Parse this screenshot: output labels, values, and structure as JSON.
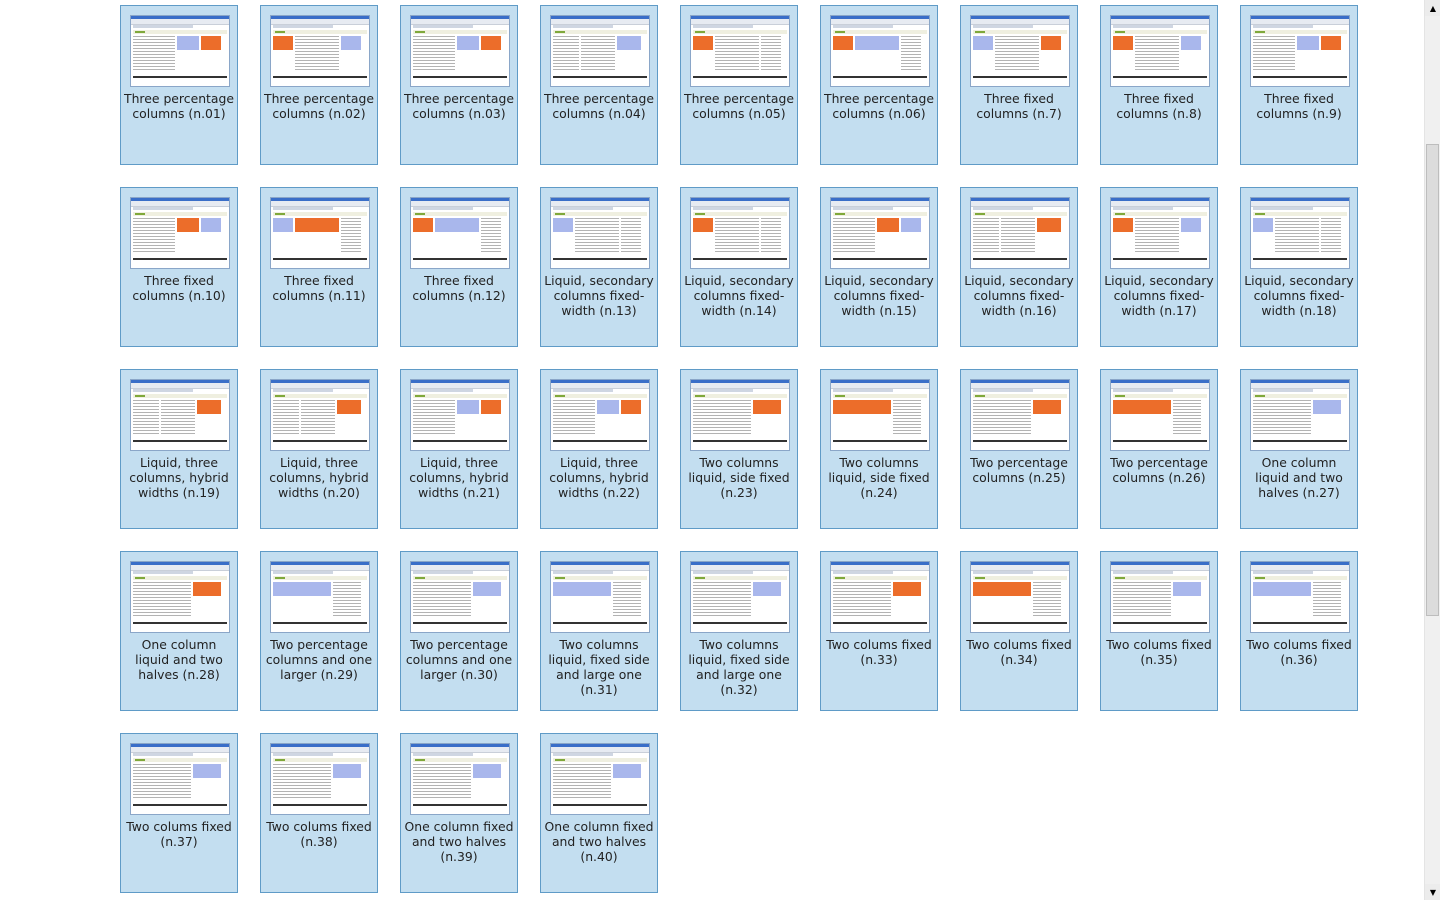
{
  "colors": {
    "card_background": "#c3def0",
    "card_border": "#5f9bc7",
    "accent_orange": "#ec6d2a",
    "accent_blue": "#a9b7ec"
  },
  "layouts": [
    {
      "label": "Three percentage columns (n.01)",
      "columns": [
        "text",
        "blue",
        "orange"
      ]
    },
    {
      "label": "Three percentage columns (n.02)",
      "columns": [
        "orange",
        "text",
        "blue"
      ]
    },
    {
      "label": "Three percentage columns (n.03)",
      "columns": [
        "text",
        "blue",
        "orange"
      ]
    },
    {
      "label": "Three percentage columns (n.04)",
      "columns": [
        "text",
        "text",
        "blue"
      ]
    },
    {
      "label": "Three percentage columns (n.05)",
      "columns": [
        "orange",
        "text",
        "text"
      ]
    },
    {
      "label": "Three percentage columns (n.06)",
      "columns": [
        "orange",
        "blue",
        "text"
      ]
    },
    {
      "label": "Three fixed columns (n.7)",
      "columns": [
        "blue",
        "text",
        "orange"
      ]
    },
    {
      "label": "Three fixed columns (n.8)",
      "columns": [
        "orange",
        "text",
        "blue"
      ]
    },
    {
      "label": "Three fixed columns (n.9)",
      "columns": [
        "text",
        "blue",
        "orange"
      ]
    },
    {
      "label": "Three fixed columns (n.10)",
      "columns": [
        "text",
        "orange",
        "blue"
      ]
    },
    {
      "label": "Three fixed columns (n.11)",
      "columns": [
        "blue",
        "orange",
        "text"
      ]
    },
    {
      "label": "Three fixed columns (n.12)",
      "columns": [
        "orange",
        "blue",
        "text"
      ]
    },
    {
      "label": "Liquid, secondary columns fixed-width (n.13)",
      "columns": [
        "blue",
        "text",
        "text"
      ]
    },
    {
      "label": "Liquid, secondary columns fixed-width (n.14)",
      "columns": [
        "orange",
        "text",
        "text"
      ]
    },
    {
      "label": "Liquid, secondary columns fixed-width (n.15)",
      "columns": [
        "text",
        "orange",
        "blue"
      ]
    },
    {
      "label": "Liquid, secondary columns fixed-width (n.16)",
      "columns": [
        "text",
        "text",
        "orange"
      ]
    },
    {
      "label": "Liquid, secondary columns fixed-width (n.17)",
      "columns": [
        "orange",
        "text",
        "blue"
      ]
    },
    {
      "label": "Liquid, secondary columns fixed-width (n.18)",
      "columns": [
        "blue",
        "text",
        "text"
      ]
    },
    {
      "label": "Liquid, three columns, hybrid widths (n.19)",
      "columns": [
        "text",
        "text",
        "orange"
      ]
    },
    {
      "label": "Liquid, three columns, hybrid widths (n.20)",
      "columns": [
        "text",
        "text",
        "orange"
      ]
    },
    {
      "label": "Liquid, three columns, hybrid widths (n.21)",
      "columns": [
        "text",
        "blue",
        "orange"
      ]
    },
    {
      "label": "Liquid, three columns, hybrid widths (n.22)",
      "columns": [
        "text",
        "blue",
        "orange"
      ]
    },
    {
      "label": "Two columns liquid, side fixed (n.23)",
      "columns": [
        "text",
        "orange"
      ]
    },
    {
      "label": "Two columns liquid, side fixed (n.24)",
      "columns": [
        "orange",
        "text"
      ]
    },
    {
      "label": "Two percentage columns (n.25)",
      "columns": [
        "text",
        "orange"
      ]
    },
    {
      "label": "Two percentage columns (n.26)",
      "columns": [
        "orange",
        "text"
      ]
    },
    {
      "label": "One column liquid and two halves (n.27)",
      "columns": [
        "text",
        "blue"
      ]
    },
    {
      "label": "One column liquid and two halves (n.28)",
      "columns": [
        "text",
        "orange"
      ]
    },
    {
      "label": "Two percentage columns and one larger (n.29)",
      "columns": [
        "blue",
        "text"
      ]
    },
    {
      "label": "Two percentage columns and one larger (n.30)",
      "columns": [
        "text",
        "blue"
      ]
    },
    {
      "label": "Two columns liquid, fixed side and large one (n.31)",
      "columns": [
        "blue",
        "text"
      ]
    },
    {
      "label": "Two columns liquid, fixed side and large one (n.32)",
      "columns": [
        "text",
        "blue"
      ]
    },
    {
      "label": "Two colums fixed (n.33)",
      "columns": [
        "text",
        "orange"
      ]
    },
    {
      "label": "Two colums fixed (n.34)",
      "columns": [
        "orange",
        "text"
      ]
    },
    {
      "label": "Two colums fixed (n.35)",
      "columns": [
        "text",
        "blue"
      ]
    },
    {
      "label": "Two colums fixed (n.36)",
      "columns": [
        "blue",
        "text"
      ]
    },
    {
      "label": "Two colums fixed (n.37)",
      "columns": [
        "text",
        "blue"
      ]
    },
    {
      "label": "Two colums fixed (n.38)",
      "columns": [
        "text",
        "blue"
      ]
    },
    {
      "label": "One column fixed and two halves (n.39)",
      "columns": [
        "text",
        "blue"
      ]
    },
    {
      "label": "One column fixed and two halves (n.40)",
      "columns": [
        "text",
        "blue"
      ]
    }
  ],
  "scrollbar": {
    "up_icon": "up-arrow",
    "down_icon": "down-arrow",
    "up_glyph": "▲",
    "down_glyph": "▼",
    "position_fraction": 0.18
  }
}
